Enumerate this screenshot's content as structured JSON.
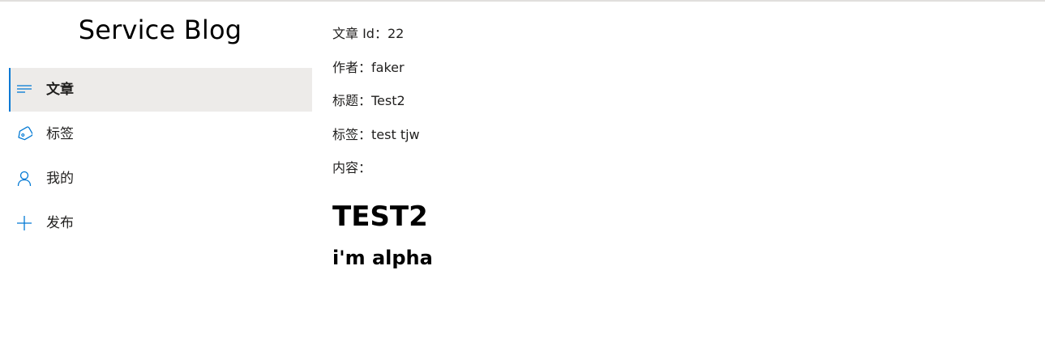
{
  "brand": {
    "title": "Service Blog"
  },
  "nav": {
    "items": [
      {
        "label": "文章",
        "icon": "text-align-icon",
        "active": true
      },
      {
        "label": "标签",
        "icon": "tag-icon",
        "active": false
      },
      {
        "label": "我的",
        "icon": "person-icon",
        "active": false
      },
      {
        "label": "发布",
        "icon": "plus-icon",
        "active": false
      }
    ]
  },
  "article": {
    "id_row": "文章 Id：22",
    "author_row": "作者：faker",
    "title_row": "标题：Test2",
    "tags_row": "标签：test tjw",
    "content_label": "内容：",
    "body_h1": "TEST2",
    "body_h2": "i'm alpha"
  },
  "colors": {
    "accent": "#0078d4",
    "active_bg": "#edebe9"
  }
}
